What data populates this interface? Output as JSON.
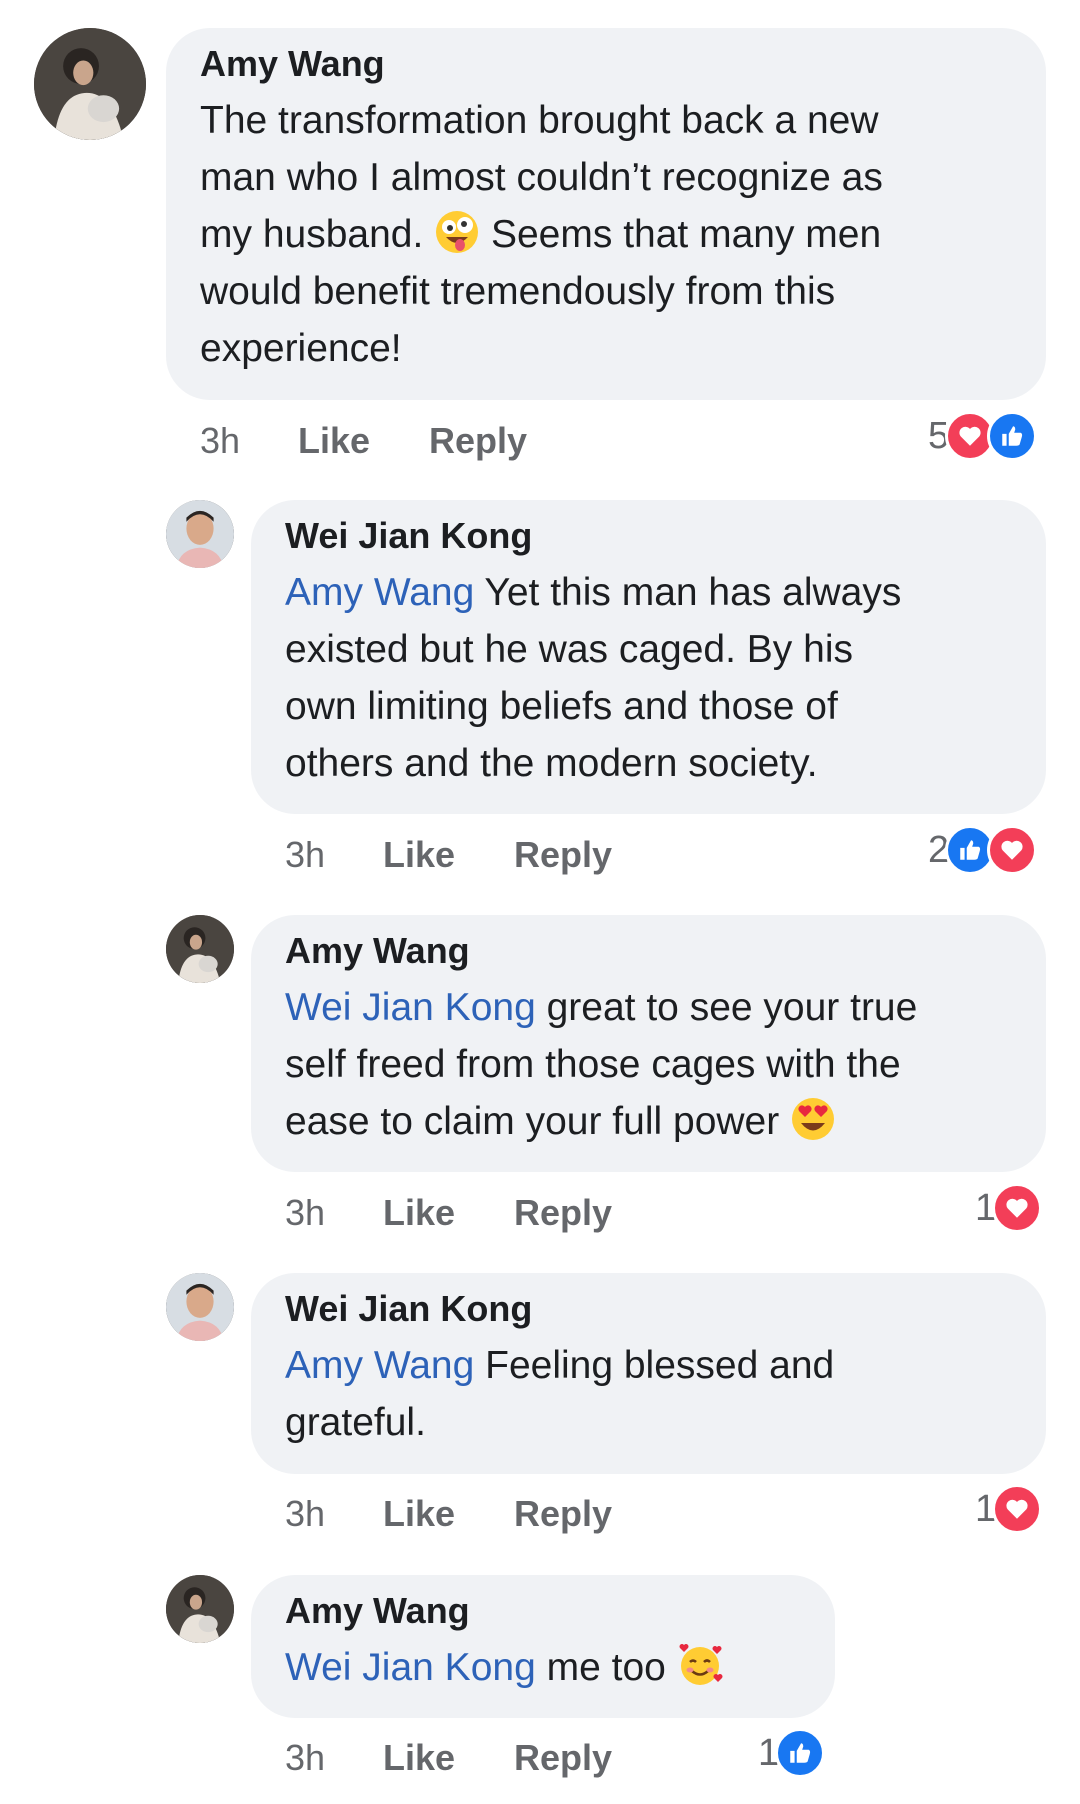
{
  "colors": {
    "bubble": "#f0f2f5",
    "mention": "#2d62b8",
    "like_blue": "#1877f2",
    "love_red": "#f33e58",
    "meta_gray": "#65676b"
  },
  "comments": [
    {
      "author": "Amy Wang",
      "mention": "",
      "text_a": "The transformation brought back a new",
      "text_b": "man who I almost couldn’t recognize as",
      "text_c": "my husband. ",
      "emoji_1": "zany-face-emoji",
      "text_d": " Seems that many men",
      "text_e": "would benefit tremendously from this",
      "text_f": "experience!",
      "time": "3h",
      "like": "Like",
      "reply": "Reply",
      "reaction_count": "5",
      "reactions": [
        "love-reaction-icon",
        "like-reaction-icon"
      ]
    },
    {
      "author": "Wei Jian Kong",
      "mention": "Amy Wang",
      "text_a": " Yet this man has always",
      "text_b": "existed but he was caged. By his",
      "text_c": "own limiting beliefs and those of",
      "text_d": "others and the modern society.",
      "time": "3h",
      "like": "Like",
      "reply": "Reply",
      "reaction_count": "2",
      "reactions": [
        "like-reaction-icon",
        "love-reaction-icon"
      ]
    },
    {
      "author": "Amy Wang",
      "mention": "Wei Jian Kong",
      "text_a": " great to see your true",
      "text_b": "self freed from those cages with the",
      "text_c": "ease to claim your full power ",
      "emoji_1": "heart-eyes-emoji",
      "time": "3h",
      "like": "Like",
      "reply": "Reply",
      "reaction_count": "1",
      "reactions": [
        "love-reaction-icon"
      ]
    },
    {
      "author": "Wei Jian Kong",
      "mention": "Amy Wang",
      "text_a": " Feeling blessed and",
      "text_b": "grateful.",
      "time": "3h",
      "like": "Like",
      "reply": "Reply",
      "reaction_count": "1",
      "reactions": [
        "love-reaction-icon"
      ]
    },
    {
      "author": "Amy Wang",
      "mention": "Wei Jian Kong",
      "text_a": " me too ",
      "emoji_1": "smiling-face-with-hearts-emoji",
      "time": "3h",
      "like": "Like",
      "reply": "Reply",
      "reaction_count": "1",
      "reactions": [
        "like-reaction-icon"
      ]
    }
  ]
}
